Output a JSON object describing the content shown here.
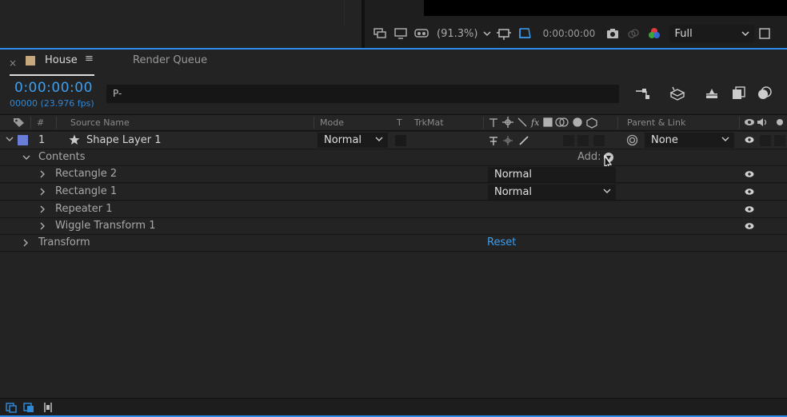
{
  "viewer": {
    "zoom": "(91.3%)",
    "timecode": "0:00:00:00",
    "resolution": "Full"
  },
  "panel": {
    "close_label": "×",
    "comp_tab": "House",
    "menu_glyph": "≡",
    "render_queue_tab": "Render Queue"
  },
  "time": {
    "current": "0:00:00:00",
    "frames_fps": "00000 (23.976 fps)",
    "search_glyph": "P-"
  },
  "columns": {
    "number": "#",
    "source_name": "Source Name",
    "mode": "Mode",
    "t": "T",
    "trkmat": "TrkMat",
    "parent_link": "Parent & Link"
  },
  "layer": {
    "number": "1",
    "name": "Shape Layer 1",
    "mode": "Normal",
    "parent": "None",
    "label_color": "#6a7ed8"
  },
  "contents": {
    "label": "Contents",
    "add_label": "Add:",
    "items": [
      {
        "name": "Rectangle 2",
        "blend": "Normal"
      },
      {
        "name": "Rectangle 1",
        "blend": "Normal"
      },
      {
        "name": "Repeater 1"
      },
      {
        "name": "Wiggle Transform 1"
      }
    ]
  },
  "transform": {
    "label": "Transform",
    "reset": "Reset"
  },
  "colors": {
    "accent_blue": "#2d8ceb",
    "timecode_blue": "#3c9ff0"
  }
}
